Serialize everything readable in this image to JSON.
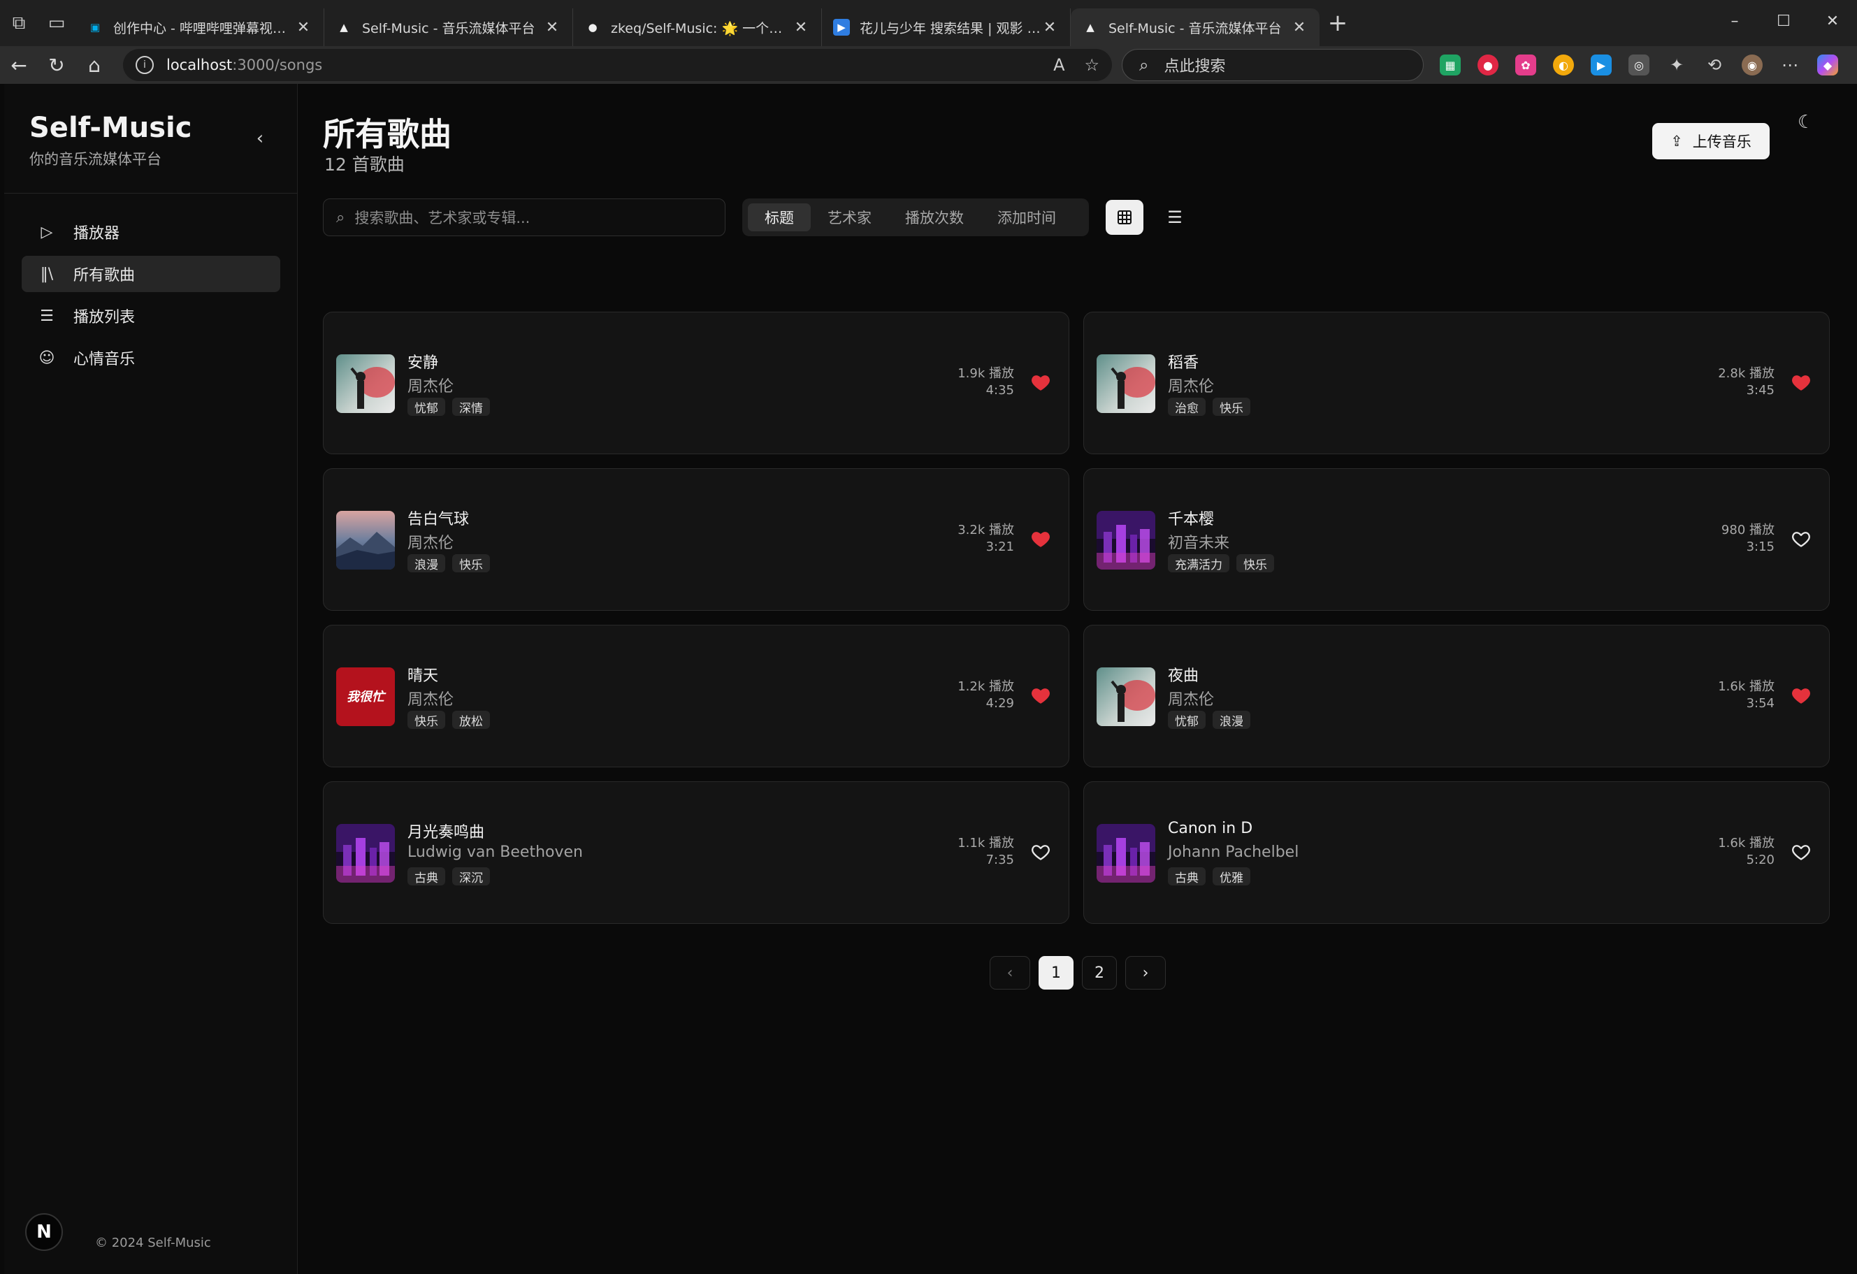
{
  "browser": {
    "tabs": [
      {
        "title": "创作中心 - 哔哩哔哩弹幕视频网 -",
        "favicon": "bilibili-icon",
        "color": "#00aeec",
        "active": false
      },
      {
        "title": "Self-Music - 音乐流媒体平台",
        "favicon": "triangle-icon",
        "color": "#111111",
        "active": false
      },
      {
        "title": "zkeq/Self-Music: 🌟 一个现代化的",
        "favicon": "github-icon",
        "color": "#111111",
        "active": false
      },
      {
        "title": "花儿与少年 搜索结果 | 观影 GYING",
        "favicon": "play-icon",
        "color": "#2f7de1",
        "active": false
      },
      {
        "title": "Self-Music - 音乐流媒体平台",
        "favicon": "triangle-icon",
        "color": "#111111",
        "active": true
      }
    ],
    "url_host": "localhost",
    "url_path": ":3000/songs",
    "search_placeholder": "点此搜索"
  },
  "sidebar": {
    "title": "Self-Music",
    "subtitle": "你的音乐流媒体平台",
    "items": [
      {
        "label": "播放器",
        "icon": "play-icon",
        "active": false
      },
      {
        "label": "所有歌曲",
        "icon": "library-icon",
        "active": true
      },
      {
        "label": "播放列表",
        "icon": "list-icon",
        "active": false
      },
      {
        "label": "心情音乐",
        "icon": "smile-icon",
        "active": false
      }
    ],
    "avatar_letter": "N",
    "copyright": "© 2024 Self-Music"
  },
  "header": {
    "title": "所有歌曲",
    "count": "12 首歌曲",
    "upload_label": "上传音乐"
  },
  "toolbar": {
    "search_placeholder": "搜索歌曲、艺术家或专辑...",
    "sort_options": [
      "标题",
      "艺术家",
      "播放次数",
      "添加时间"
    ],
    "sort_active": "标题"
  },
  "songs": [
    {
      "title": "安静",
      "artist": "周杰伦",
      "tags": [
        "忧郁",
        "深情"
      ],
      "plays": "1.9k 播放",
      "duration": "4:35",
      "liked": true,
      "cover": "figure"
    },
    {
      "title": "稻香",
      "artist": "周杰伦",
      "tags": [
        "治愈",
        "快乐"
      ],
      "plays": "2.8k 播放",
      "duration": "3:45",
      "liked": true,
      "cover": "figure"
    },
    {
      "title": "告白气球",
      "artist": "周杰伦",
      "tags": [
        "浪漫",
        "快乐"
      ],
      "plays": "3.2k 播放",
      "duration": "3:21",
      "liked": true,
      "cover": "landscape"
    },
    {
      "title": "千本樱",
      "artist": "初音未来",
      "tags": [
        "充满活力",
        "快乐"
      ],
      "plays": "980 播放",
      "duration": "3:15",
      "liked": false,
      "cover": "city"
    },
    {
      "title": "晴天",
      "artist": "周杰伦",
      "tags": [
        "快乐",
        "放松"
      ],
      "plays": "1.2k 播放",
      "duration": "4:29",
      "liked": true,
      "cover": "red",
      "cover_text": "我很忙"
    },
    {
      "title": "夜曲",
      "artist": "周杰伦",
      "tags": [
        "忧郁",
        "浪漫"
      ],
      "plays": "1.6k 播放",
      "duration": "3:54",
      "liked": true,
      "cover": "figure"
    },
    {
      "title": "月光奏鸣曲",
      "artist": "Ludwig van Beethoven",
      "tags": [
        "古典",
        "深沉"
      ],
      "plays": "1.1k 播放",
      "duration": "7:35",
      "liked": false,
      "cover": "city"
    },
    {
      "title": "Canon in D",
      "artist": "Johann Pachelbel",
      "tags": [
        "古典",
        "优雅"
      ],
      "plays": "1.6k 播放",
      "duration": "5:20",
      "liked": false,
      "cover": "city"
    }
  ],
  "pagination": {
    "pages": [
      "1",
      "2"
    ],
    "current": "1"
  },
  "colors": {
    "like": "#e5323c",
    "background": "#0a0a0a",
    "card": "#141414"
  }
}
